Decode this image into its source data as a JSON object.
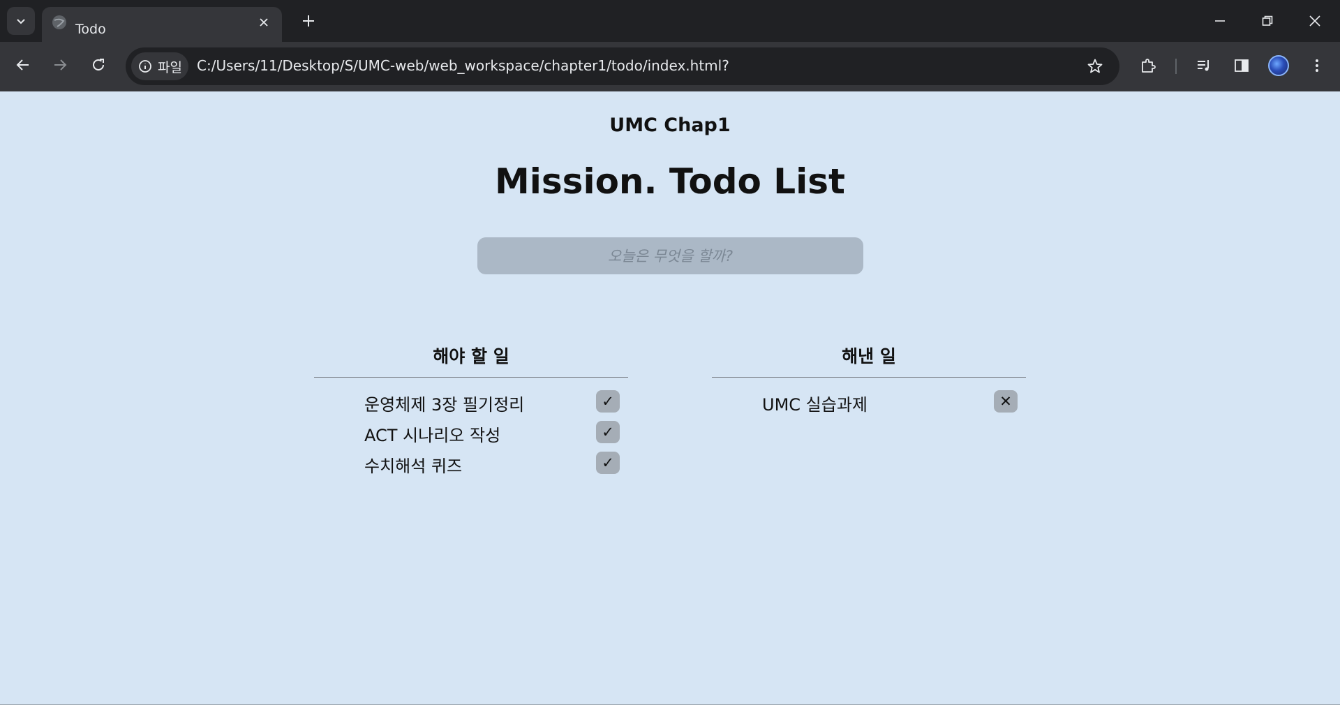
{
  "browser": {
    "tab_title": "Todo",
    "site_chip_label": "파일",
    "url": "C:/Users/11/Desktop/S/UMC-web/web_workspace/chapter1/todo/index.html?"
  },
  "page": {
    "subtitle": "UMC Chap1",
    "title": "Mission. Todo List",
    "input_placeholder": "오늘은 무엇을 할까?",
    "todo": {
      "heading": "해야 할 일",
      "items": [
        {
          "text": "운영체제 3장 필기정리",
          "action": "✓"
        },
        {
          "text": "ACT 시나리오 작성",
          "action": "✓"
        },
        {
          "text": "수치해석 퀴즈",
          "action": "✓"
        }
      ]
    },
    "done": {
      "heading": "해낸 일",
      "items": [
        {
          "text": "UMC 실습과제",
          "action": "✕"
        }
      ]
    }
  }
}
